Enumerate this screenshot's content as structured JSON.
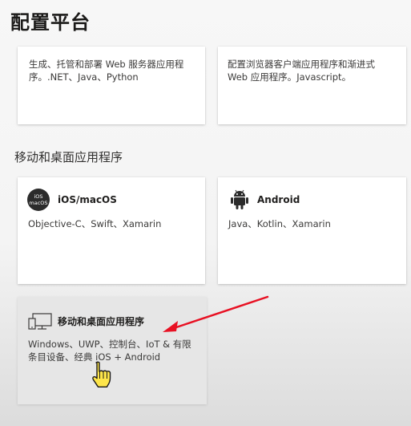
{
  "page": {
    "title": "配置平台"
  },
  "web_cards": [
    {
      "description_line1": "生成、托管和部署 Web 服务器应用程",
      "description_line2": "序。.NET、Java、Python"
    },
    {
      "description_line1": "配置浏览器客户端应用程序和渐进式",
      "description_line2": "Web 应用程序。Javascript。"
    }
  ],
  "mobile_section": {
    "heading": "移动和桌面应用程序",
    "cards": [
      {
        "icon": "apple-ios-icon",
        "icon_text_line1": "iOS",
        "icon_text_line2": "macOS",
        "title": "iOS/macOS",
        "description_line1": "Objective-C、Swift、Xamarin",
        "description_line2": ""
      },
      {
        "icon": "android-icon",
        "title": "Android",
        "description_line1": "Java、Kotlin、Xamarin",
        "description_line2": ""
      },
      {
        "icon": "desktop-monitor-icon",
        "title": "移动和桌面应用程序",
        "description_line1": "Windows、UWP、控制台、IoT & 有限",
        "description_line2": "条目设备、经典 iOS + Android"
      }
    ]
  },
  "annotation": {
    "arrow_color": "#e81123",
    "cursor": "hand-pointer-icon"
  }
}
